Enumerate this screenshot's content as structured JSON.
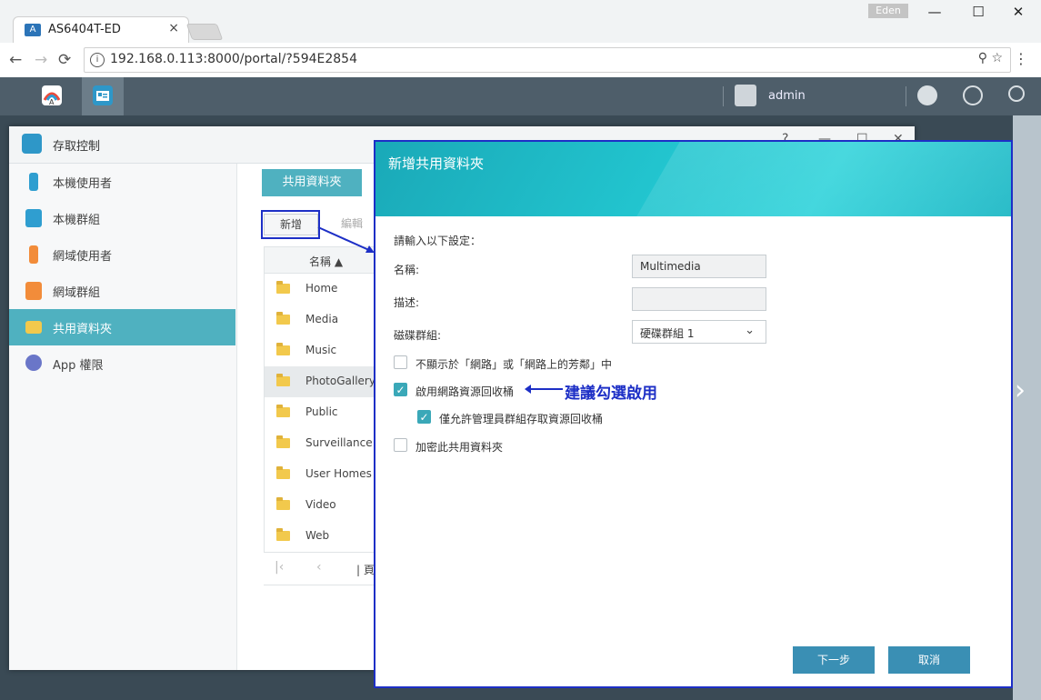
{
  "browser": {
    "tab_title": "AS6404T-ED",
    "tab_close": "×",
    "user_badge": "Eden",
    "minimize": "—",
    "maximize": "☐",
    "close": "✕",
    "back": "←",
    "forward": "→",
    "reload": "⟳",
    "info": "i",
    "url": "192.168.0.113:8000/portal/?594E2854",
    "url_icons": "⚲ ☆",
    "menu": "⋮"
  },
  "adm": {
    "user": "admin"
  },
  "access_window": {
    "title": "存取控制",
    "sidebar": [
      {
        "label": "本機使用者",
        "color": "#2f9ed0"
      },
      {
        "label": "本機群組",
        "color": "#2f9ed0"
      },
      {
        "label": "網域使用者",
        "color": "#f28c3a"
      },
      {
        "label": "網域群組",
        "color": "#f28c3a"
      },
      {
        "label": "共用資料夾",
        "color": "#f2c94c"
      },
      {
        "label": "App 權限",
        "color": "#6a76c8"
      }
    ],
    "tab": "共用資料夾",
    "add_button": "新增",
    "edit_button": "編輯",
    "list_header": "名稱 ▲",
    "folders": [
      "Home",
      "Media",
      "Music",
      "PhotoGallery",
      "Public",
      "Surveillance",
      "User Homes",
      "Video",
      "Web"
    ],
    "pager": {
      "first": "|‹",
      "prev": "‹",
      "page_label": "| 頁"
    }
  },
  "dialog": {
    "title": "新增共用資料夾",
    "intro": "請輸入以下設定：",
    "name_label": "名稱:",
    "name_value": "Multimedia",
    "desc_label": "描述:",
    "desc_value": "",
    "volume_label": "磁碟群組:",
    "volume_value": "硬碟群組 1",
    "opt_hide": "不顯示於「網路」或「網路上的芳鄰」中",
    "opt_recycle": "啟用網路資源回收桶",
    "opt_admin_only": "僅允許管理員群組存取資源回收桶",
    "opt_encrypt": "加密此共用資料夾",
    "annotation": "建議勾選啟用",
    "next_button": "下一步",
    "cancel_button": "取消",
    "checks": {
      "hide": false,
      "recycle": true,
      "admin_only": true,
      "encrypt": false
    },
    "check_mark": "✓"
  },
  "colors": {
    "accent": "#4fb1c0",
    "annotation": "#1d2fc6",
    "button": "#3a8fb4"
  }
}
